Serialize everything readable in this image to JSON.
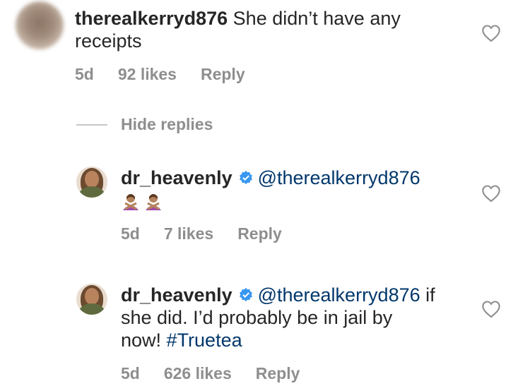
{
  "comments": [
    {
      "username": "therealkerryd876",
      "text": "She didn’t have any receipts",
      "time": "5d",
      "likes": "92 likes",
      "reply": "Reply"
    }
  ],
  "hide_replies": "Hide replies",
  "replies": [
    {
      "username": "dr_heavenly",
      "mention": "@therealkerryd876",
      "emoji": [
        "person-gesturing-no",
        "person-gesturing-no"
      ],
      "time": "5d",
      "likes": "7 likes",
      "reply": "Reply"
    },
    {
      "username": "dr_heavenly",
      "mention": "@therealkerryd876",
      "text_after_mention": " if",
      "line2": "she did. I’d probably be in jail by",
      "line3_start": "now! ",
      "hashtag": "#Truetea",
      "time": "5d",
      "likes": "626 likes",
      "reply": "Reply"
    }
  ],
  "colors": {
    "text": "#262626",
    "meta": "#8e8e8e",
    "link": "#00376b",
    "verified": "#3897f0"
  }
}
